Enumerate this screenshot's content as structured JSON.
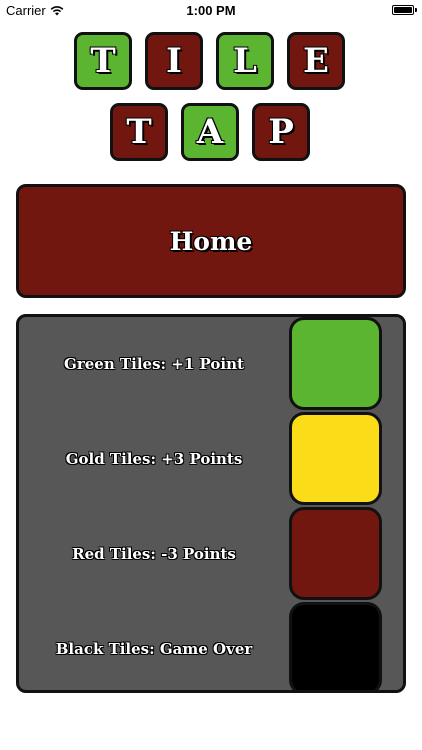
{
  "status_bar": {
    "carrier": "Carrier",
    "time": "1:00 PM",
    "battery_level": 1.0
  },
  "title": {
    "row1": [
      {
        "letter": "T",
        "color": "#5bb531"
      },
      {
        "letter": "I",
        "color": "#711710"
      },
      {
        "letter": "L",
        "color": "#5bb531"
      },
      {
        "letter": "E",
        "color": "#711710"
      }
    ],
    "row2": [
      {
        "letter": "T",
        "color": "#711710"
      },
      {
        "letter": "A",
        "color": "#5bb531"
      },
      {
        "letter": "P",
        "color": "#711710"
      }
    ]
  },
  "home_button": {
    "label": "Home",
    "color": "#711710"
  },
  "legend": {
    "panel_color": "#575757",
    "items": [
      {
        "label": "Green Tiles: +1 Point",
        "color": "#5bb531"
      },
      {
        "label": "Gold Tiles: +3 Points",
        "color": "#fbdc19"
      },
      {
        "label": "Red Tiles: -3 Points",
        "color": "#711710"
      },
      {
        "label": "Black Tiles: Game Over",
        "color": "#000000"
      }
    ]
  }
}
